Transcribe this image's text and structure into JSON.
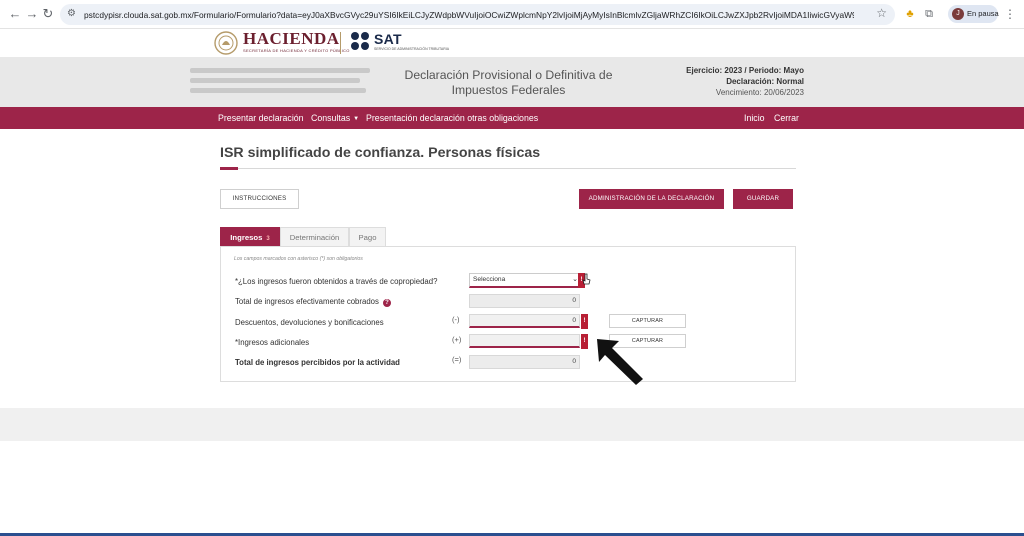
{
  "browser": {
    "url": "pstcdypisr.clouda.sat.gob.mx/Formulario/Formulario?data=eyJ0aXBvcGVyc29uYSI6IkEiLCJyZWdpbWVuIjoiOCwiZWplcmNpY2lvIjoiMjAyMyIsInBlcmlvZGljaWRhZCI6IkOiLCJwZXJpb2RvIjoiMDA1IiwicGVyaW9kb0Rlc2MiOiJNYXlvIiwiZmVjaGFGDY...",
    "profile_initial": "J",
    "profile_status": "En pausa"
  },
  "logos": {
    "hacienda": "HACIENDA",
    "hacienda_sub": "SECRETARÍA DE HACIENDA Y CRÉDITO PÚBLICO",
    "sat": "SAT",
    "sat_sub": "SERVICIO DE ADMINISTRACIÓN TRIBUTARIA"
  },
  "header": {
    "title": "Declaración Provisional o Definitiva de Impuestos Federales",
    "ejercicio_line": "Ejercicio: 2023 / Periodo: Mayo",
    "declaracion_line": "Declaración: Normal",
    "vencimiento_line": "Vencimiento: 20/06/2023"
  },
  "nav": {
    "presentar": "Presentar declaración",
    "consultas": "Consultas",
    "otras": "Presentación declaración otras obligaciones",
    "inicio": "Inicio",
    "cerrar": "Cerrar"
  },
  "page": {
    "title": "ISR simplificado de confianza. Personas físicas"
  },
  "toolbar": {
    "instrucciones": "INSTRUCCIONES",
    "administracion": "ADMINISTRACIÓN DE LA DECLARACIÓN",
    "guardar": "GUARDAR"
  },
  "tabs": [
    {
      "label": "Ingresos",
      "badge": "3"
    },
    {
      "label": "Determinación"
    },
    {
      "label": "Pago"
    }
  ],
  "form": {
    "required_note": "Los campos marcados con asterisco (*) son obligatorios",
    "copropiedad_label": "*¿Los ingresos fueron obtenidos a través de copropiedad?",
    "copropiedad_value": "Selecciona",
    "total_cobrados_label": "Total de ingresos efectivamente cobrados",
    "total_cobrados_value": "0",
    "descuentos_label": "Descuentos, devoluciones y bonificaciones",
    "descuentos_sign": "(-)",
    "descuentos_value": "0",
    "adicionales_label": "*Ingresos adicionales",
    "adicionales_sign": "(+)",
    "adicionales_value": "",
    "total_percibidos_label": "Total de ingresos percibidos por la actividad",
    "total_percibidos_sign": "(=)",
    "total_percibidos_value": "0",
    "capturar_label": "CAPTURAR",
    "error_mark": "!",
    "help_mark": "?"
  },
  "colors": {
    "maroon": "#9d2449",
    "error_red": "#b81f35"
  }
}
